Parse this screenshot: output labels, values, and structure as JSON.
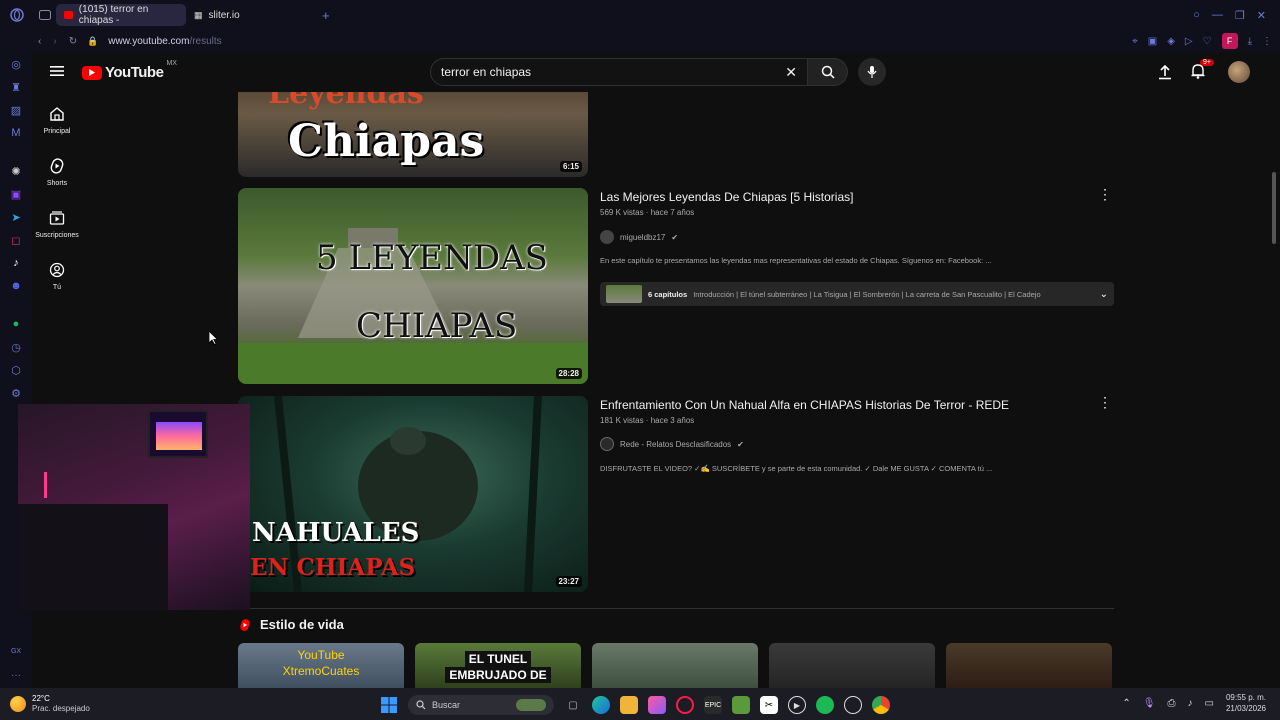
{
  "browser": {
    "tabs": [
      {
        "label": "(1015) terror en chiapas - "
      },
      {
        "label": "sliter.io"
      }
    ],
    "new_tab": "+",
    "url_host": "www.youtube.com",
    "url_path": "/results",
    "profile_letter": "F"
  },
  "youtube": {
    "logo_text": "YouTube",
    "region": "MX",
    "search_value": "terror en chiapas",
    "notifications_badge": "9+",
    "nav": [
      {
        "label": "Principal"
      },
      {
        "label": "Shorts"
      },
      {
        "label": "Suscripciones"
      },
      {
        "label": "Tú"
      }
    ]
  },
  "results": [
    {
      "thumb_text": "Chiapas",
      "thumb_top_text": "Leyendas",
      "duration": "6:15"
    },
    {
      "title": "Las Mejores Leyendas De Chiapas [5 Historias]",
      "meta": "569 K vistas · hace 7 años",
      "channel": "migueldbz17",
      "description": "En este capítulo te presentamos las leyendas mas representativas del estado de Chiapas. Síguenos en: Facebook: ...",
      "thumb_text_1": "5 LEYENDAS",
      "thumb_text_2": "CHIAPAS",
      "duration": "28:28",
      "chapters_count": "6 capítulos",
      "chapters_list": "Introducción | El túnel subterráneo | La Tisigua | El Sombrerón | La carreta de San Pascualito | El Cadejo"
    },
    {
      "title": "Enfrentamiento Con Un Nahual Alfa en CHIAPAS Historias De Terror - REDE",
      "meta": "181 K vistas · hace 3 años",
      "channel": "Rede - Relatos Desclasificados",
      "description": "DISFRUTASTE EL VIDEO? ✓✍ SUSCRÍBETE y se parte de esta comunidad. ✓ Dale ME GUSTA ✓ COMENTA tú ...",
      "thumb_text_1": "NAHUALES",
      "thumb_text_2": "EN CHIAPAS",
      "duration": "23:27"
    }
  ],
  "shelf": {
    "title": "Estilo de vida",
    "thumbs": [
      {
        "line1": "YouTube",
        "line2": "XtremoCuates"
      },
      {
        "line1": "EL TUNEL",
        "line2": "EMBRUJADO DE"
      },
      {
        "line1": "",
        "line2": ""
      },
      {
        "line1": "",
        "line2": ""
      },
      {
        "line1": "",
        "line2": ""
      }
    ]
  },
  "taskbar": {
    "temp": "22°C",
    "weather": "Prac. despejado",
    "search_label": "Buscar",
    "time": "09:55 p. m.",
    "date": "21/03/2026",
    "gx_label": "GX"
  },
  "colors": {
    "yt_red": "#ff0000",
    "bg": "#0f0f0f",
    "opera_accent": "#6d7bd8"
  }
}
